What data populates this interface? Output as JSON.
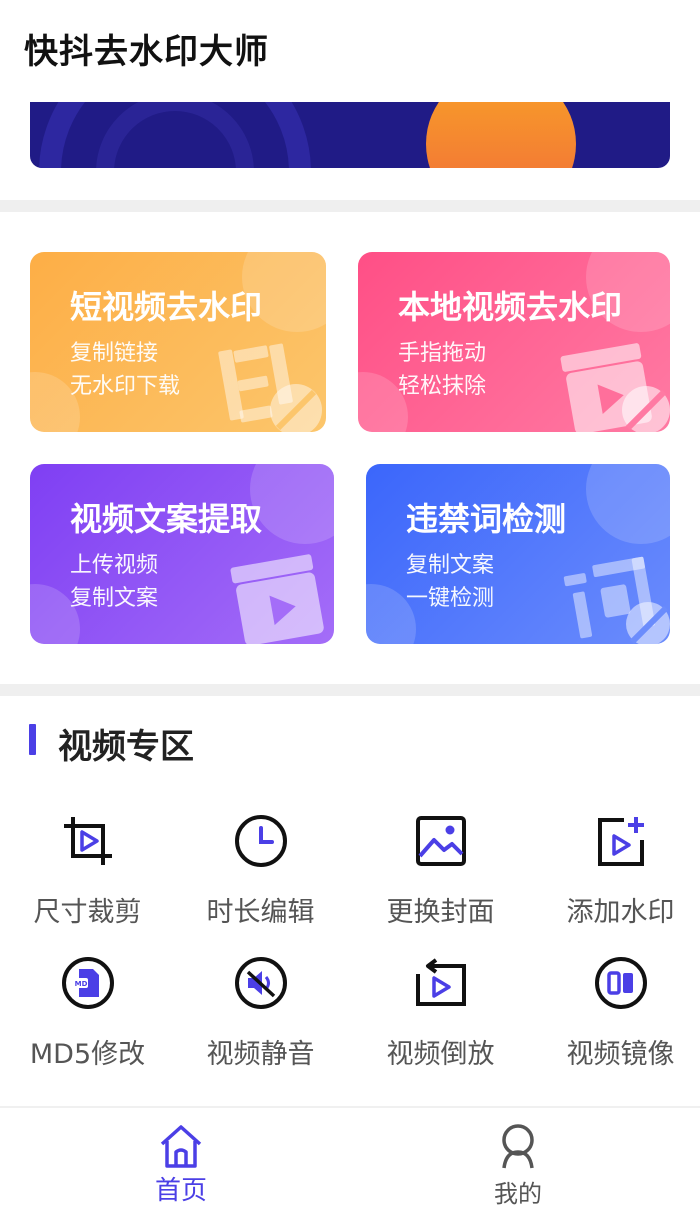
{
  "header": {
    "title": "快抖去水印大师"
  },
  "features": [
    {
      "title": "短视频去水印",
      "line1": "复制链接",
      "line2": "无水印下载",
      "icon": "watermark-stamp-icon"
    },
    {
      "title": "本地视频去水印",
      "line1": "手指拖动",
      "line2": "轻松抹除",
      "icon": "clapperboard-erase-icon"
    },
    {
      "title": "视频文案提取",
      "line1": "上传视频",
      "line2": "复制文案",
      "icon": "clapperboard-play-icon"
    },
    {
      "title": "违禁词检测",
      "line1": "复制文案",
      "line2": "一键检测",
      "icon": "word-check-icon"
    }
  ],
  "video_section": {
    "title": "视频专区",
    "tools": [
      {
        "label": "尺寸裁剪",
        "icon": "crop-icon"
      },
      {
        "label": "时长编辑",
        "icon": "clock-icon"
      },
      {
        "label": "更换封面",
        "icon": "image-icon"
      },
      {
        "label": "添加水印",
        "icon": "add-watermark-icon"
      },
      {
        "label": "MD5修改",
        "icon": "md5-file-icon"
      },
      {
        "label": "视频静音",
        "icon": "mute-icon"
      },
      {
        "label": "视频倒放",
        "icon": "reverse-play-icon"
      },
      {
        "label": "视频镜像",
        "icon": "mirror-icon"
      }
    ]
  },
  "tabbar": {
    "tabs": [
      {
        "label": "首页",
        "icon": "home-icon",
        "active": true
      },
      {
        "label": "我的",
        "icon": "profile-icon",
        "active": false
      }
    ]
  },
  "colors": {
    "accent": "#4b3fe6",
    "card_orange": "#fba84b",
    "card_pink": "#ff5b8d",
    "card_purple": "#8a4cf5",
    "card_blue": "#3d6cfb",
    "banner": "#201b86"
  }
}
